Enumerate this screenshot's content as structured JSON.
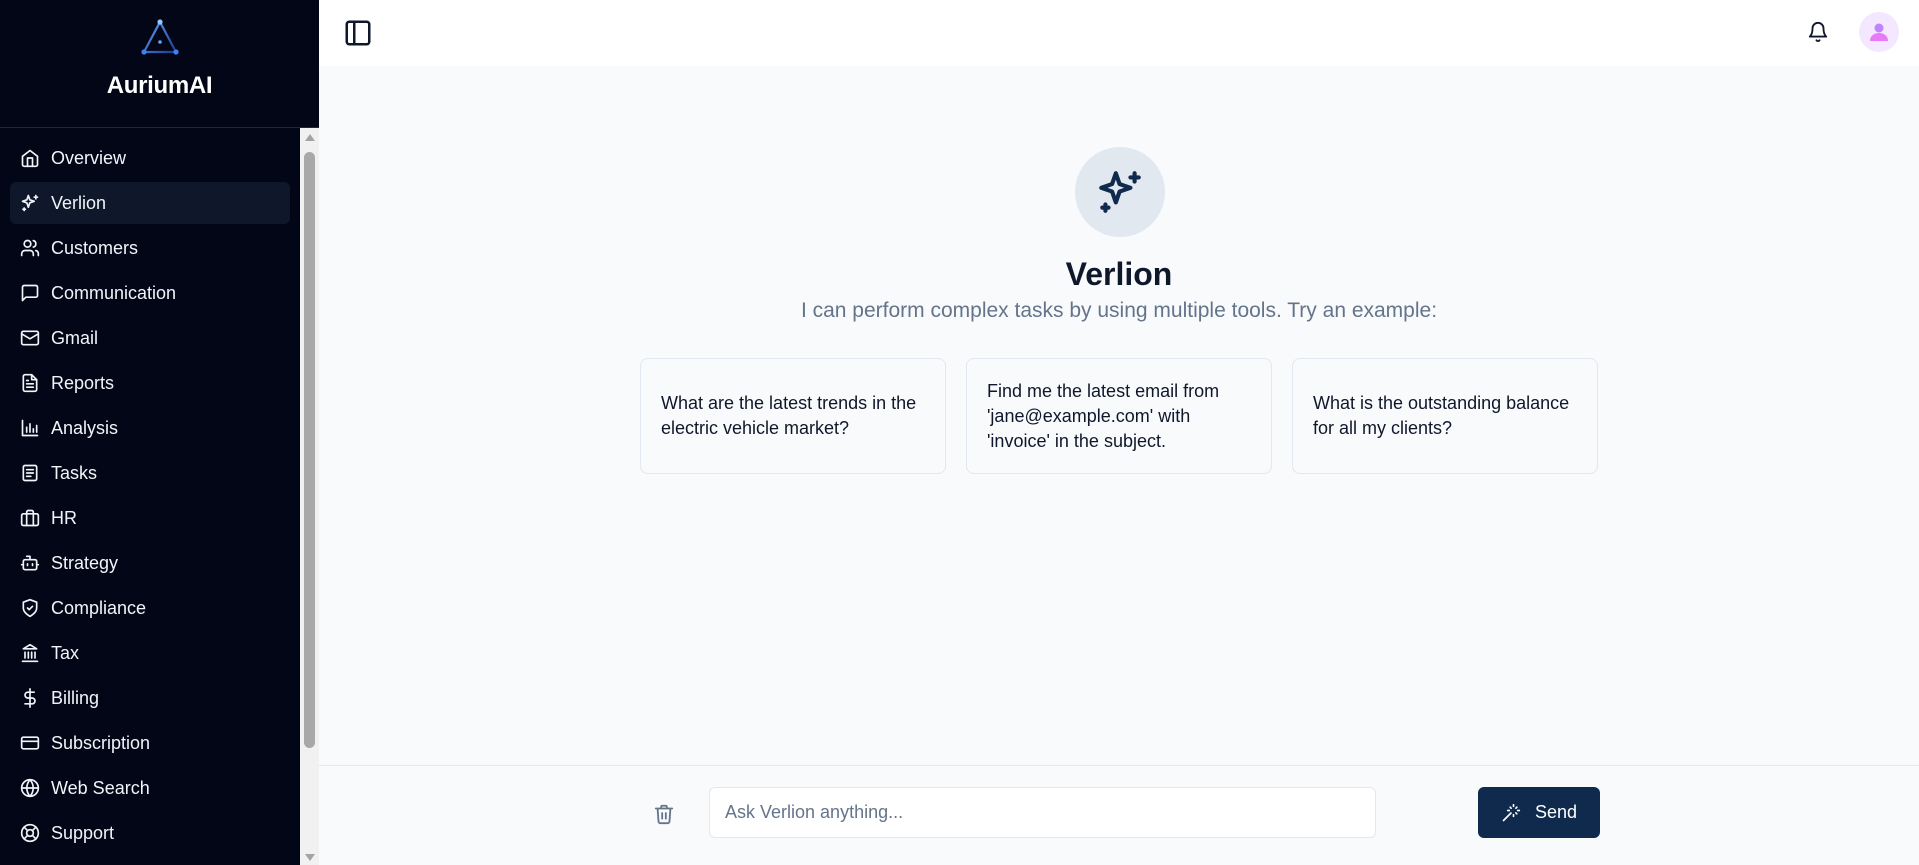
{
  "app": {
    "name": "AuriumAI"
  },
  "sidebar": {
    "items": [
      {
        "label": "Overview",
        "icon": "home-icon"
      },
      {
        "label": "Verlion",
        "icon": "sparkles-icon",
        "active": true
      },
      {
        "label": "Customers",
        "icon": "users-icon"
      },
      {
        "label": "Communication",
        "icon": "message-square-icon"
      },
      {
        "label": "Gmail",
        "icon": "mail-icon"
      },
      {
        "label": "Reports",
        "icon": "file-text-icon"
      },
      {
        "label": "Analysis",
        "icon": "bar-chart-icon"
      },
      {
        "label": "Tasks",
        "icon": "clipboard-list-icon"
      },
      {
        "label": "HR",
        "icon": "briefcase-icon"
      },
      {
        "label": "Strategy",
        "icon": "bot-icon"
      },
      {
        "label": "Compliance",
        "icon": "shield-check-icon"
      },
      {
        "label": "Tax",
        "icon": "landmark-icon"
      },
      {
        "label": "Billing",
        "icon": "dollar-sign-icon"
      },
      {
        "label": "Subscription",
        "icon": "credit-card-icon"
      },
      {
        "label": "Web Search",
        "icon": "globe-icon"
      },
      {
        "label": "Support",
        "icon": "life-buoy-icon"
      }
    ]
  },
  "main": {
    "title": "Verlion",
    "subtitle": "I can perform complex tasks by using multiple tools. Try an example:",
    "examples": [
      "What are the latest trends in the electric vehicle market?",
      "Find me the latest email from 'jane@example.com' with 'invoice' in the subject.",
      "What is the outstanding balance for all my clients?"
    ]
  },
  "chat": {
    "placeholder": "Ask Verlion anything...",
    "send_label": "Send"
  },
  "colors": {
    "sidebar_bg": "#020617",
    "active_item_bg": "#0f172a",
    "primary": "#0f2a4d",
    "muted_text": "#64748b"
  }
}
